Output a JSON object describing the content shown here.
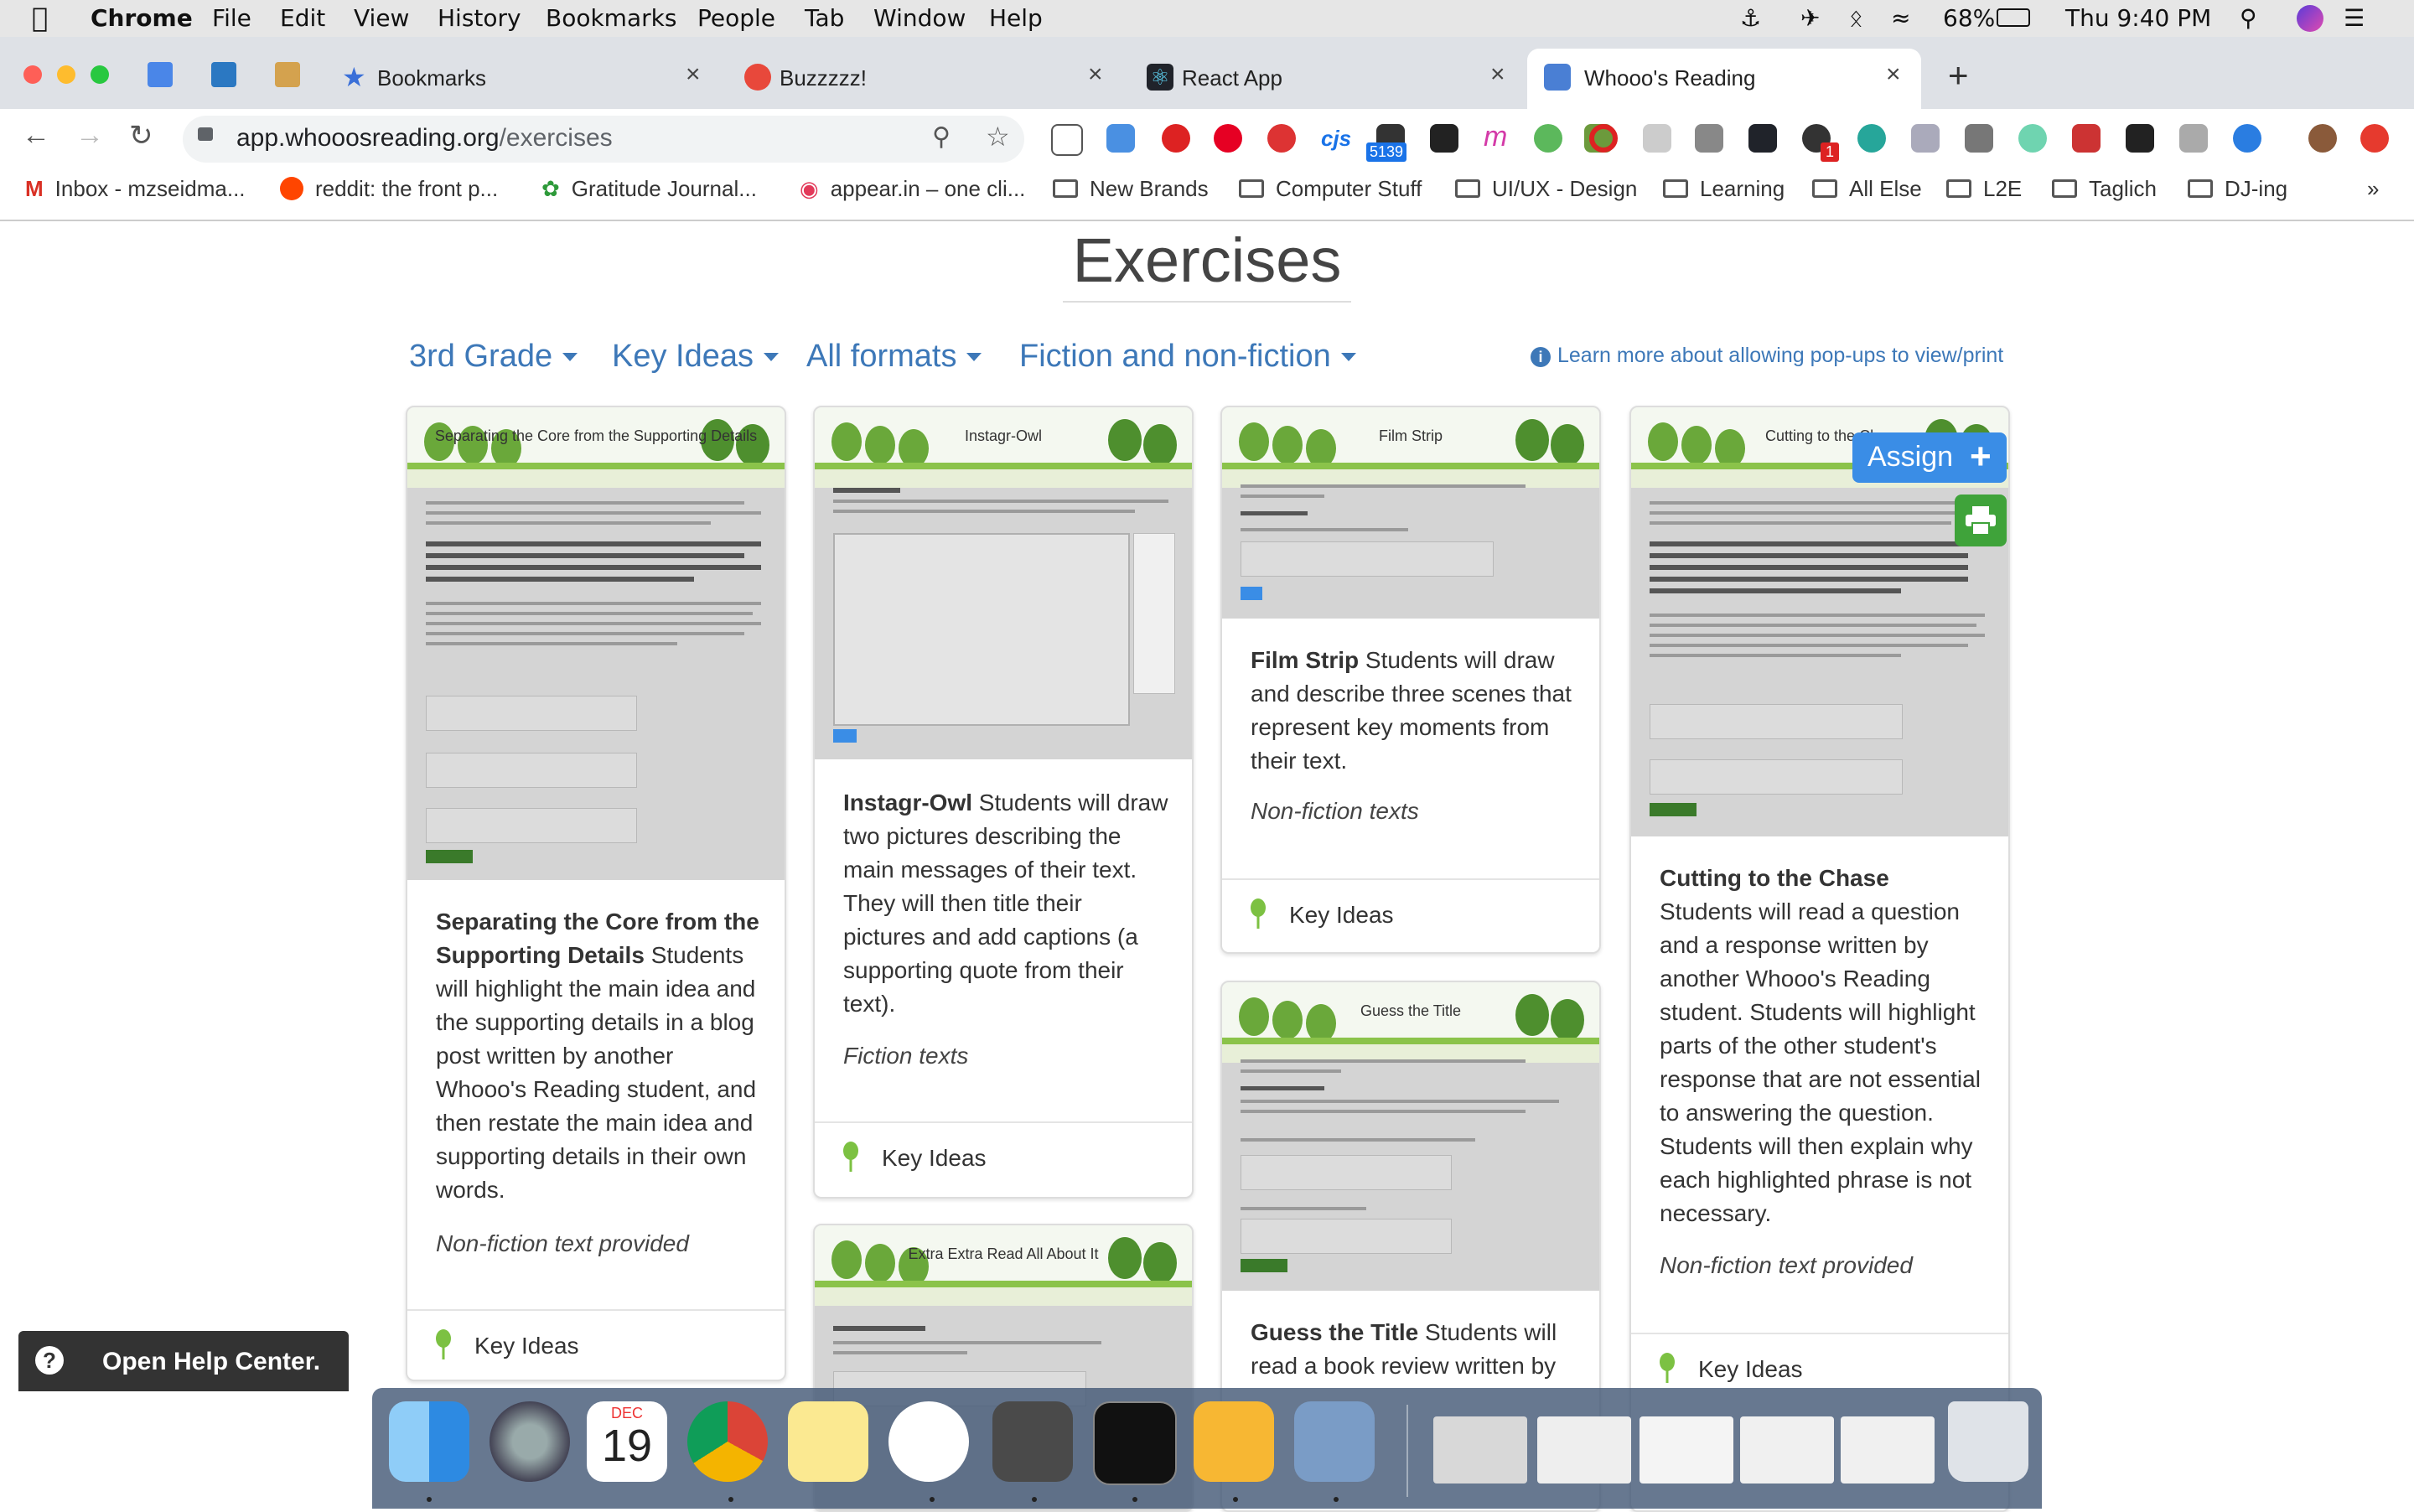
{
  "menubar": {
    "app": "Chrome",
    "items": [
      "File",
      "Edit",
      "View",
      "History",
      "Bookmarks",
      "People",
      "Tab",
      "Window",
      "Help"
    ],
    "battery": "68%",
    "clock": "Thu 9:40 PM"
  },
  "tabs": [
    {
      "title": "Bookmarks",
      "icon": "star-icon"
    },
    {
      "title": "Buzzzzz!",
      "icon": "tomato-icon"
    },
    {
      "title": "React App",
      "icon": "react-icon"
    },
    {
      "title": "Whooo's Reading",
      "icon": "owl-icon",
      "active": true
    }
  ],
  "address": {
    "host": "app.whooosreading.org",
    "path": "/exercises"
  },
  "extensions": {
    "badge_count": "5139",
    "notification": "1"
  },
  "bookmarks": [
    {
      "label": "Inbox - mzseidma...",
      "icon": "gmail-icon"
    },
    {
      "label": "reddit: the front p...",
      "icon": "reddit-icon"
    },
    {
      "label": "Gratitude Journal...",
      "icon": "leaf-icon"
    },
    {
      "label": "appear.in – one cli...",
      "icon": "appear-icon"
    },
    {
      "label": "New Brands",
      "icon": "folder-icon"
    },
    {
      "label": "Computer Stuff",
      "icon": "folder-icon"
    },
    {
      "label": "UI/UX - Design",
      "icon": "folder-icon"
    },
    {
      "label": "Learning",
      "icon": "folder-icon"
    },
    {
      "label": "All Else",
      "icon": "folder-icon"
    },
    {
      "label": "L2E",
      "icon": "folder-icon"
    },
    {
      "label": "Taglich",
      "icon": "folder-icon"
    },
    {
      "label": "DJ-ing",
      "icon": "folder-icon"
    }
  ],
  "page": {
    "title": "Exercises",
    "filters": [
      "3rd Grade",
      "Key Ideas",
      "All formats",
      "Fiction and non-fiction"
    ],
    "popup_link": "Learn more about allowing pop-ups to view/print",
    "assign_label": "Assign",
    "help_label": "Open Help Center."
  },
  "cards": [
    {
      "thumb_title": "Separating the Core from the Supporting Details",
      "name": "Separating the Core from the Supporting Details",
      "desc": "Students will highlight the main idea and the supporting details in a blog post written by another Whooo's Reading student, and then restate the main idea and supporting details in their own words.",
      "format": "Non-fiction text provided",
      "tag": "Key Ideas"
    },
    {
      "thumb_title": "Instagr-Owl",
      "name": "Instagr-Owl",
      "desc": "Students will draw two pictures describing the main messages of their text. They will then title their pictures and add captions (a supporting quote from their text).",
      "format": "Fiction texts",
      "tag": "Key Ideas"
    },
    {
      "thumb_title": "Extra Extra Read All About It",
      "name": "",
      "desc": "",
      "format": "",
      "tag": ""
    },
    {
      "thumb_title": "Film Strip",
      "name": "Film Strip",
      "desc": "Students will draw and describe three scenes that represent key moments from their text.",
      "format": "Non-fiction texts",
      "tag": "Key Ideas"
    },
    {
      "thumb_title": "Guess the Title",
      "name": "Guess the Title",
      "desc": "Students will read a book review written by",
      "format": "",
      "tag": ""
    },
    {
      "thumb_title": "Cutting to the Chase",
      "name": "Cutting to the Chase",
      "desc": "Students will read a question and a response written by another Whooo's Reading student. Students will highlight parts of the other student's response that are not essential to answering the question. Students will then explain why each highlighted phrase is not necessary.",
      "format": "Non-fiction text provided",
      "tag": "Key Ideas"
    }
  ],
  "dock": {
    "calendar_month": "DEC",
    "calendar_day": "19"
  },
  "colors": {
    "link": "#3d78b8",
    "assign": "#3a8de6",
    "print": "#3fa33a",
    "tree": "#7cc142"
  }
}
